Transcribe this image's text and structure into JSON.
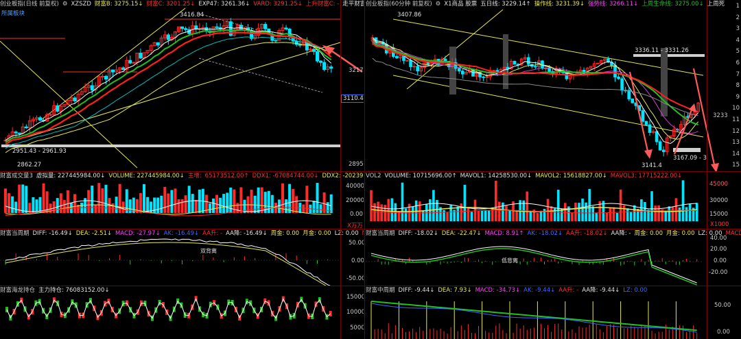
{
  "colors": {
    "up": "#ff2a2a",
    "down": "#00e5ff",
    "ma_yellow": "#e8e850",
    "ma_green": "#22c022",
    "ma_red": "#ff2020",
    "ma_white": "#ffffff",
    "ma_purple": "#d040d0",
    "ma_cyan": "#00c0c0",
    "support_band": "#cfcfcf",
    "axis_text": "#c8c8c8",
    "arrow": "#ff5a5a"
  },
  "left": {
    "main": {
      "header": [
        {
          "text": "创业板指(日线 前复权)",
          "color": "#c8c8c8"
        },
        {
          "text": "⚙",
          "color": "#c8c8c8",
          "icon": "settings-icon"
        },
        {
          "text": "XZSZD",
          "color": "#e0e0e0"
        },
        {
          "text": "财富B: 3275.15↓",
          "color": "#e8e850"
        },
        {
          "text": "财富C: 3201.25↓",
          "color": "#ff3030"
        },
        {
          "text": "EXP47: 3261.36↓",
          "color": "#e0e0e0"
        },
        {
          "text": "VARD: 3291.25↓",
          "color": "#ff3030"
        },
        {
          "text": "上升财富C: -",
          "color": "#ff3030"
        },
        {
          "text": "走平财富C: -",
          "color": "#e0e0e0"
        }
      ],
      "subtitle": "所属板块",
      "high_label": "3416.84",
      "low_band_label": "2951.43 - 2961.93",
      "low_label": "2862.27",
      "axis_labels": [
        {
          "value": "3217",
          "color": "#c8c8c8"
        },
        {
          "value": "3110.4",
          "color": "#ffffff",
          "boxed": true
        },
        {
          "value": "2895",
          "color": "#c8c8c8"
        }
      ]
    },
    "vol": {
      "header": [
        {
          "text": "财富成交量3",
          "color": "#c8c8c8"
        },
        {
          "text": "虚拟量: 227445984.00↓",
          "color": "#e0e0e0"
        },
        {
          "text": "VOLUME: 227445984.00↓",
          "color": "#e8e850"
        },
        {
          "text": "主增:",
          "color": "#ff3030"
        },
        {
          "text": "65173512.00↑",
          "color": "#ff3030"
        },
        {
          "text": "DDX1: -67084744.00↓",
          "color": "#ff3030"
        },
        {
          "text": "DDX2: -2023969",
          "color": "#e8e850"
        }
      ],
      "axis_labels": [
        "40000",
        "20000",
        "0.00"
      ],
      "unit": "X万万"
    },
    "macd": {
      "header": [
        {
          "text": "财富当周期",
          "color": "#c8c8c8"
        },
        {
          "text": "DIFF: -16.49↓",
          "color": "#e0e0e0"
        },
        {
          "text": "DEA: -2.51↓",
          "color": "#e8e850"
        },
        {
          "text": "MACD: -27.97↓",
          "color": "#ff40ff"
        },
        {
          "text": "AK: -16.49↓",
          "color": "#3a6bff"
        },
        {
          "text": "AA升: -",
          "color": "#ff3030"
        },
        {
          "text": "AA降: -16.49↓",
          "color": "#e0e0e0"
        },
        {
          "text": "周金: 0.00",
          "color": "#e8e850"
        },
        {
          "text": "月金: 0.00",
          "color": "#e8e850"
        },
        {
          "text": "LZ: 0.00",
          "color": "#e0e0e0"
        },
        {
          "text": "MACD",
          "color": "#ff3030"
        }
      ],
      "axis_labels": [
        "50.00",
        "0.00",
        "-50.00"
      ],
      "annotation": "双背离"
    },
    "dragon": {
      "header": [
        {
          "text": "财富海龙持仓",
          "color": "#c8c8c8"
        },
        {
          "text": "主力持仓: 76083152.00↓",
          "color": "#e0e0e0"
        }
      ],
      "axis_labels": [
        "15000",
        "10000",
        "5000"
      ]
    }
  },
  "right": {
    "main": {
      "header": [
        {
          "text": "创业板指(60分钟 前复权)",
          "color": "#c8c8c8"
        },
        {
          "text": "⚙",
          "color": "#c8c8c8",
          "icon": "settings-icon"
        },
        {
          "text": "X1商品 股票",
          "color": "#e0e0e0"
        },
        {
          "text": "五日线: 3229.14↑",
          "color": "#e0e0e0"
        },
        {
          "text": "操作线: 3231.39↓",
          "color": "#e8e850"
        },
        {
          "text": "强势线: 3266.11↓",
          "color": "#ff40ff"
        },
        {
          "text": "上周生命线: 3275.00↓",
          "color": "#22c022"
        },
        {
          "text": "上周死",
          "color": "#e0e0e0"
        }
      ],
      "high_label": "3407.86",
      "band_label": "3336.11 - 3331.26",
      "low_band_label": "3167.09 - 3",
      "low_label": "3141.4",
      "axis_right": [
        "1",
        "2",
        "3",
        "4",
        "5",
        "6",
        "7",
        "8",
        "9",
        "10",
        "11",
        "12",
        "13",
        "14",
        "15",
        "16",
        "17",
        "18",
        "19",
        "20",
        "21",
        "22",
        "23",
        "24",
        "25",
        "26",
        "27",
        "28",
        "29"
      ],
      "mid_label": "3233"
    },
    "vol": {
      "header": [
        {
          "text": "VOL2",
          "color": "#c8c8c8"
        },
        {
          "text": "VOLUME: 10715696.00↑",
          "color": "#e0e0e0"
        },
        {
          "text": "MAVOL1: 14258530.00↓",
          "color": "#e0e0e0"
        },
        {
          "text": "MAVOL2: 15618827.00↓",
          "color": "#e8e850"
        },
        {
          "text": "MAVOL3: 17715222.00↓",
          "color": "#ff3030"
        }
      ],
      "axis_labels": [
        "45000",
        "30000",
        "15000"
      ],
      "unit": "X1000"
    },
    "macd": {
      "header": [
        {
          "text": "财富当周期",
          "color": "#c8c8c8"
        },
        {
          "text": "DIFF: -18.02↓",
          "color": "#e0e0e0"
        },
        {
          "text": "DEA: -22.47↓",
          "color": "#e8e850"
        },
        {
          "text": "MACD: 8.91↑",
          "color": "#ff40ff"
        },
        {
          "text": "AK: -18.02↓",
          "color": "#3a6bff"
        },
        {
          "text": "AA升: -18.02↓",
          "color": "#ff3030"
        },
        {
          "text": "AA降: -",
          "color": "#e0e0e0"
        },
        {
          "text": "周金: 0.00",
          "color": "#e8e850"
        },
        {
          "text": "月金: 0.00",
          "color": "#e8e850"
        },
        {
          "text": "LZ: 0.00",
          "color": "#e0e0e0"
        },
        {
          "text": "MACD",
          "color": "#ff3030"
        }
      ],
      "axis_labels": [
        "40.00",
        "20.00",
        "0.00",
        "-20.00"
      ],
      "annotation": "低背离"
    },
    "mid": {
      "header": [
        {
          "text": "财富中周期",
          "color": "#c8c8c8"
        },
        {
          "text": "DIFF: -9.44↓",
          "color": "#e0e0e0"
        },
        {
          "text": "DEA: 7.93↓",
          "color": "#e8e850"
        },
        {
          "text": "MACD: -34.73↓",
          "color": "#ff40ff"
        },
        {
          "text": "AK: -9.44↓",
          "color": "#3a6bff"
        },
        {
          "text": "AA升: -",
          "color": "#ff3030"
        },
        {
          "text": "AA降: -9.44↓",
          "color": "#e0e0e0"
        },
        {
          "text": "LZ: 0.00",
          "color": "#3a6bff"
        }
      ],
      "axis_labels": [
        "50.00",
        "0.00"
      ]
    }
  }
}
